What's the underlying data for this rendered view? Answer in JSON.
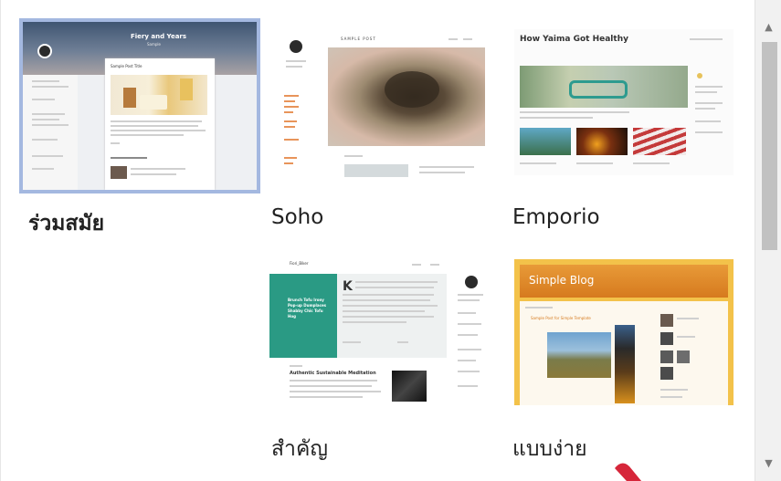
{
  "themes": [
    {
      "name": "ร่วมสมัย",
      "selected": true,
      "preview": {
        "header_title": "Fiery and Years",
        "header_sub": "Sample",
        "post_title": "Sample Post Title",
        "section": "Sample Post Title"
      }
    },
    {
      "name": "Soho",
      "selected": false,
      "preview": {
        "header_title": "SAMPLE POST"
      }
    },
    {
      "name": "Emporio",
      "selected": false,
      "preview": {
        "header_title": "How Yaima Got Healthy"
      }
    },
    {
      "name": "สำคัญ",
      "selected": false,
      "preview": {
        "brand": "Fiori_Biker",
        "hero_text": "Brunch Tofu Irony Pop-up Dumplaces Shabby Chic Tofu Hog",
        "post_title": "Authentic Sustainable Meditation"
      }
    },
    {
      "name": "แบบง่าย",
      "selected": false,
      "preview": {
        "header_title": "Simple Blog",
        "post_title": "Sample Post for Simple Template"
      }
    }
  ],
  "scrollbar": {
    "up": "▲",
    "down": "▼"
  },
  "colors": {
    "selection": "#a4b8e0",
    "cursor": "#d6263a",
    "teal": "#2a9a84",
    "orange": "#e8891e"
  }
}
